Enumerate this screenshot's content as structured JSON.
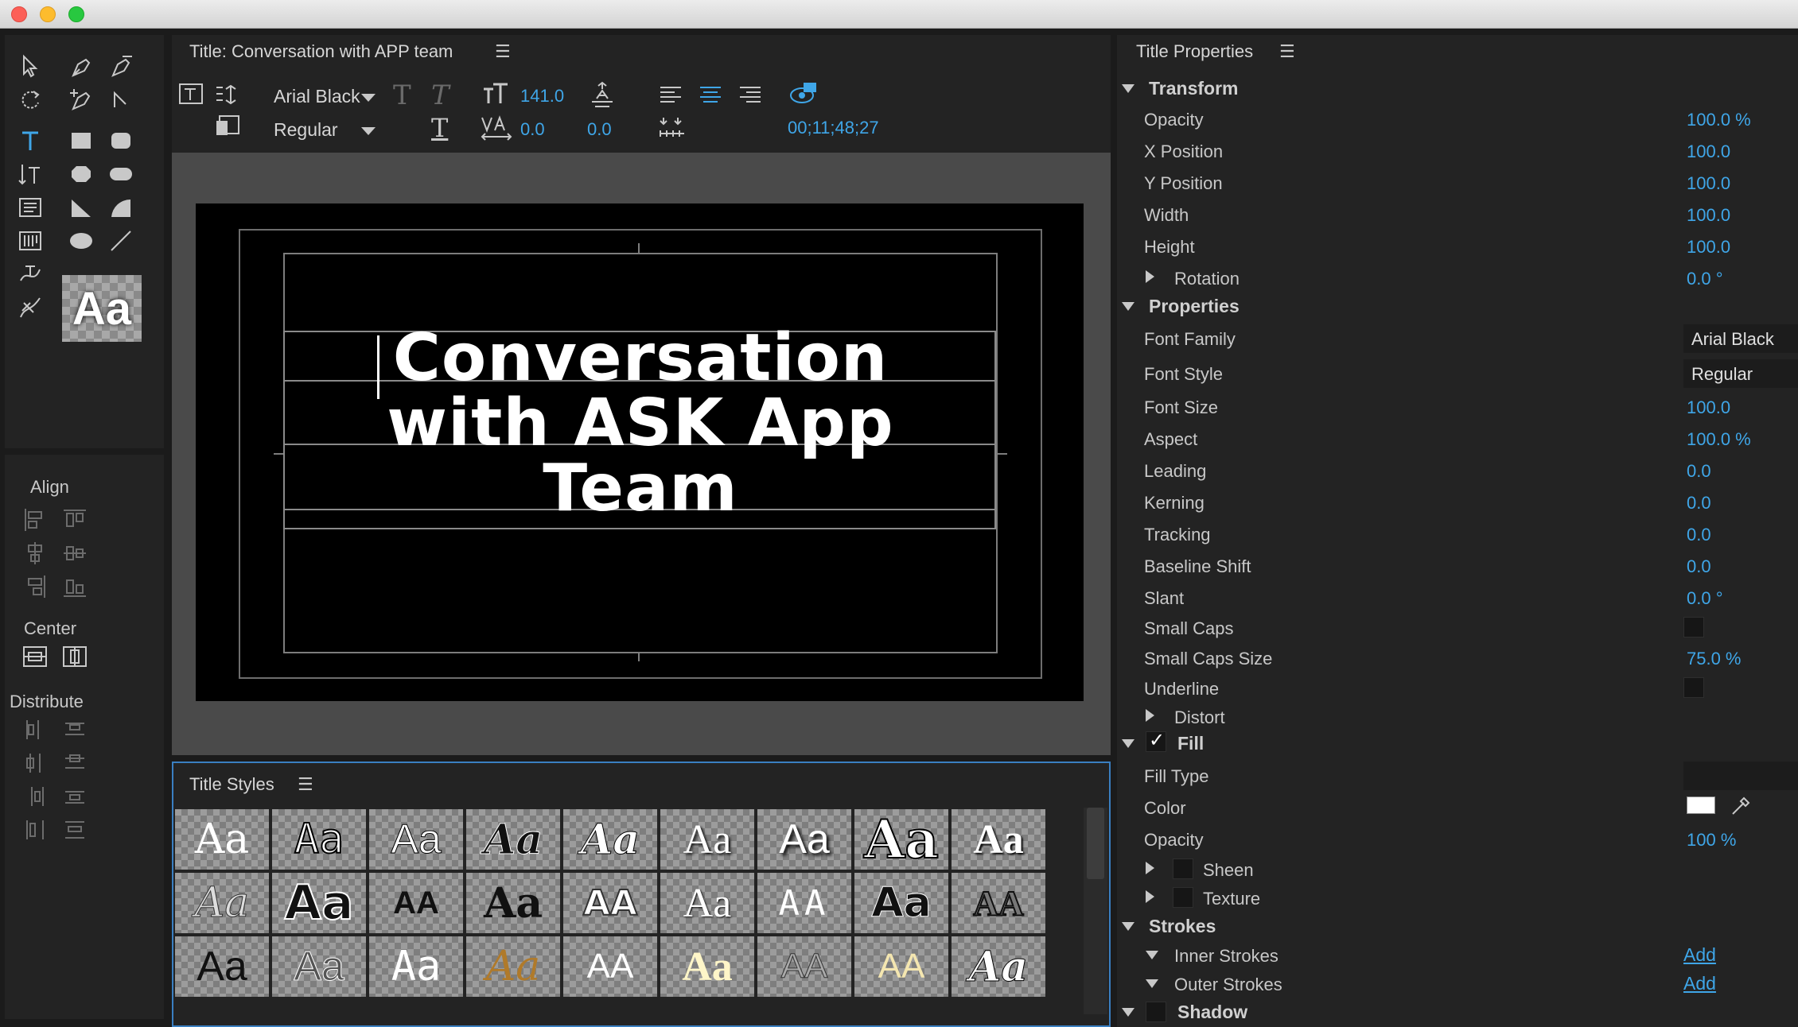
{
  "editor": {
    "panel_title": "Title: Conversation with APP team",
    "font_family": "Arial Black",
    "font_style": "Regular",
    "font_size": "141.0",
    "kerning": "0.0",
    "leading": "0.0",
    "timecode": "00;11;48;27",
    "title_lines": [
      "Conversation",
      "with ASK App",
      "Team"
    ]
  },
  "tools": {
    "style_swatch_label": "Aa"
  },
  "align_panel": {
    "align_label": "Align",
    "center_label": "Center",
    "distribute_label": "Distribute"
  },
  "styles_panel": {
    "title": "Title Styles",
    "cell_label": "Aa"
  },
  "props": {
    "panel_title": "Title Properties",
    "transform": {
      "label": "Transform",
      "opacity_label": "Opacity",
      "opacity": "100.0 %",
      "x_label": "X Position",
      "x": "100.0",
      "y_label": "Y Position",
      "y": "100.0",
      "width_label": "Width",
      "width": "100.0",
      "height_label": "Height",
      "height": "100.0",
      "rotation_label": "Rotation",
      "rotation": "0.0 °"
    },
    "properties": {
      "label": "Properties",
      "font_family_label": "Font Family",
      "font_family": "Arial Black",
      "font_style_label": "Font Style",
      "font_style": "Regular",
      "font_size_label": "Font Size",
      "font_size": "100.0",
      "aspect_label": "Aspect",
      "aspect": "100.0 %",
      "leading_label": "Leading",
      "leading": "0.0",
      "kerning_label": "Kerning",
      "kerning": "0.0",
      "tracking_label": "Tracking",
      "tracking": "0.0",
      "baseline_label": "Baseline Shift",
      "baseline": "0.0",
      "slant_label": "Slant",
      "slant": "0.0 °",
      "small_caps_label": "Small Caps",
      "small_caps_size_label": "Small Caps Size",
      "small_caps_size": "75.0 %",
      "underline_label": "Underline",
      "distort_label": "Distort"
    },
    "fill": {
      "label": "Fill",
      "fill_type_label": "Fill Type",
      "color_label": "Color",
      "color_value": "#ffffff",
      "opacity_label": "Opacity",
      "opacity": "100 %",
      "sheen_label": "Sheen",
      "texture_label": "Texture"
    },
    "strokes": {
      "label": "Strokes",
      "inner_label": "Inner Strokes",
      "outer_label": "Outer Strokes",
      "add_label": "Add"
    },
    "shadow_label": "Shadow"
  }
}
